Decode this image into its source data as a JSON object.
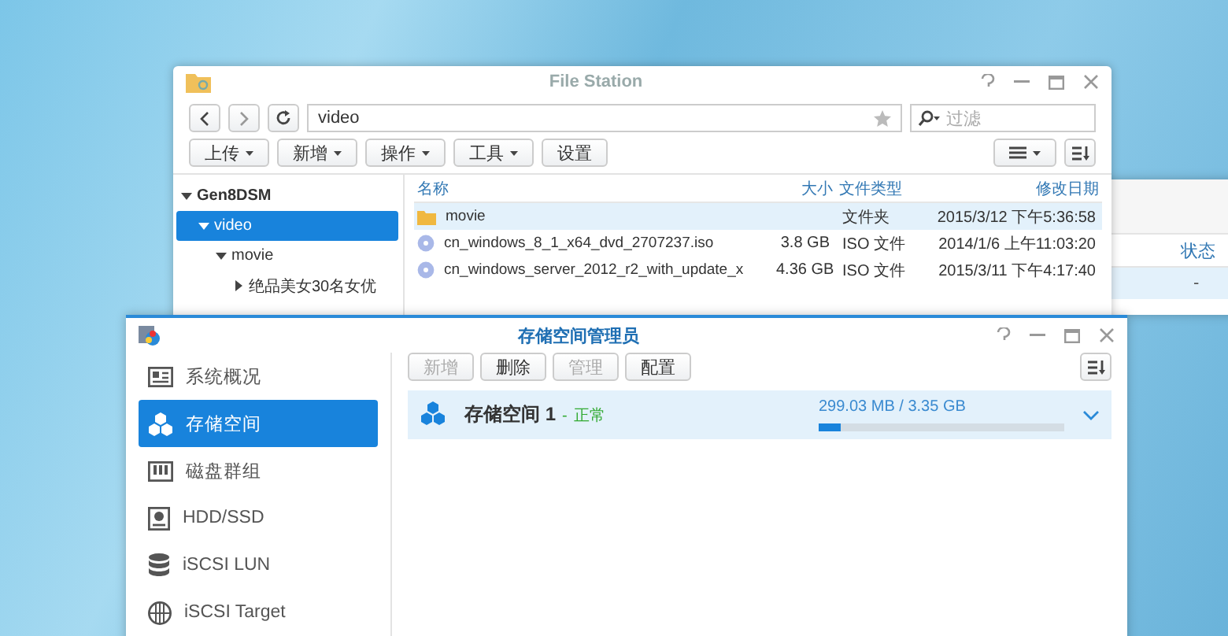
{
  "file_station": {
    "title": "File Station",
    "path": "video",
    "filter_placeholder": "过滤",
    "toolbar": [
      {
        "label": "上传",
        "dropdown": true
      },
      {
        "label": "新增",
        "dropdown": true
      },
      {
        "label": "操作",
        "dropdown": true
      },
      {
        "label": "工具",
        "dropdown": true
      },
      {
        "label": "设置",
        "dropdown": false
      }
    ],
    "tree": [
      {
        "label": "Gen8DSM",
        "expanded": true,
        "selected": false,
        "children": [
          {
            "label": "video",
            "expanded": true,
            "selected": true,
            "children": [
              {
                "label": "movie",
                "expanded": true,
                "selected": false,
                "children": [
                  {
                    "label": "绝品美女30名女优",
                    "expanded": false,
                    "selected": false
                  }
                ]
              }
            ]
          }
        ]
      }
    ],
    "columns": [
      "名称",
      "大小",
      "文件类型",
      "修改日期"
    ],
    "rows": [
      {
        "kind": "folder",
        "name": "movie",
        "type": "文件夹",
        "modified": "2015/3/12 下午5:36:58",
        "selected": true
      },
      {
        "kind": "disc",
        "name": "cn_windows_8_1_x64_dvd_2707237.iso",
        "size": "3.8 GB",
        "type": "ISO 文件",
        "modified": "2014/1/6 上午11:03:20",
        "selected": false
      },
      {
        "kind": "disc",
        "name": "cn_windows_server_2012_r2_with_update_x",
        "size": "4.36 GB",
        "type": "ISO 文件",
        "modified": "2015/3/11 下午4:17:40",
        "selected": false
      }
    ]
  },
  "background_window": {
    "column": "状态",
    "cell": "-"
  },
  "storage_manager": {
    "title": "存储空间管理员",
    "toolbar": [
      {
        "label": "新增",
        "disabled": true
      },
      {
        "label": "删除",
        "disabled": false
      },
      {
        "label": "管理",
        "disabled": true
      },
      {
        "label": "配置",
        "disabled": false
      }
    ],
    "sidebar": [
      {
        "label": "系统概况",
        "kind": "overview",
        "selected": false
      },
      {
        "label": "存储空间",
        "kind": "volume",
        "selected": true
      },
      {
        "label": "磁盘群组",
        "kind": "diskgroup",
        "selected": false
      },
      {
        "label": "HDD/SSD",
        "kind": "disk",
        "selected": false
      },
      {
        "label": "iSCSI LUN",
        "kind": "lun",
        "selected": false
      },
      {
        "label": "iSCSI Target",
        "kind": "target",
        "selected": false
      }
    ],
    "volume": {
      "name": "存储空间 1",
      "status_separator": "-",
      "status": "正常",
      "usage": "299.03 MB / 3.35 GB",
      "level": 0.09
    }
  }
}
